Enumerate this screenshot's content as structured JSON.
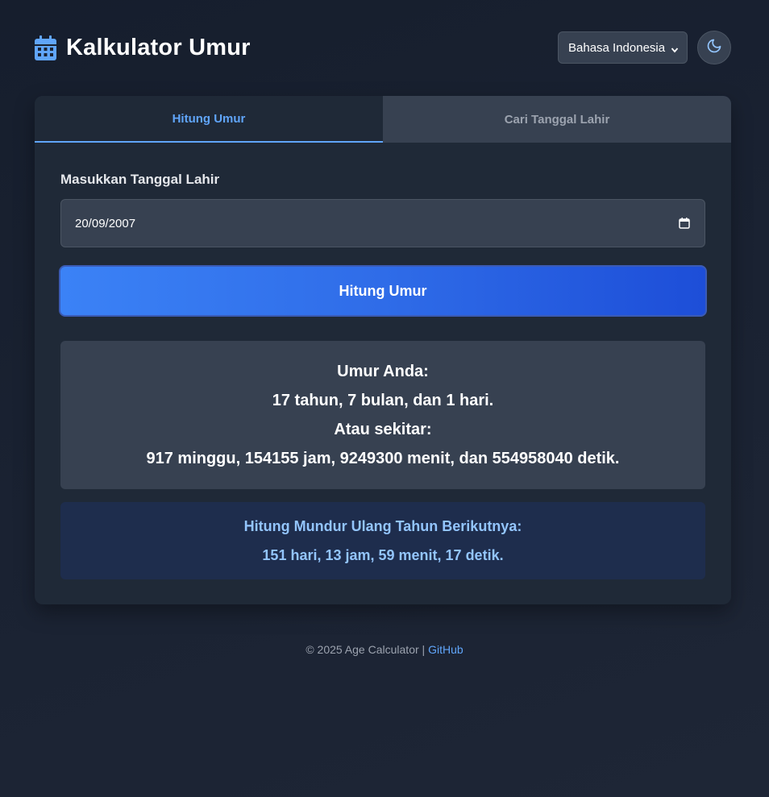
{
  "header": {
    "title": "Kalkulator Umur",
    "icon": "calendar-icon",
    "language_selected": "Bahasa Indonesia",
    "theme_toggle_icon": "moon-icon"
  },
  "tabs": [
    {
      "label": "Hitung Umur",
      "active": true
    },
    {
      "label": "Cari Tanggal Lahir",
      "active": false
    }
  ],
  "form": {
    "label": "Masukkan Tanggal Lahir",
    "date_value": "20/09/2007",
    "submit_label": "Hitung Umur"
  },
  "result": {
    "heading": "Umur Anda:",
    "age": "17 tahun, 7 bulan, dan 1 hari.",
    "alt_heading": "Atau sekitar:",
    "alt_value": "917 minggu, 154155 jam, 9249300 menit, dan 554958040 detik."
  },
  "countdown": {
    "heading": "Hitung Mundur Ulang Tahun Berikutnya:",
    "value": "151 hari, 13 jam, 59 menit, 17 detik."
  },
  "footer": {
    "text": "© 2025 Age Calculator | ",
    "link": "GitHub"
  },
  "colors": {
    "accent": "#60a5fa",
    "button_start": "#3b82f6",
    "button_end": "#1d4ed8",
    "card_bg": "#1f2937",
    "panel_bg": "#374151"
  }
}
